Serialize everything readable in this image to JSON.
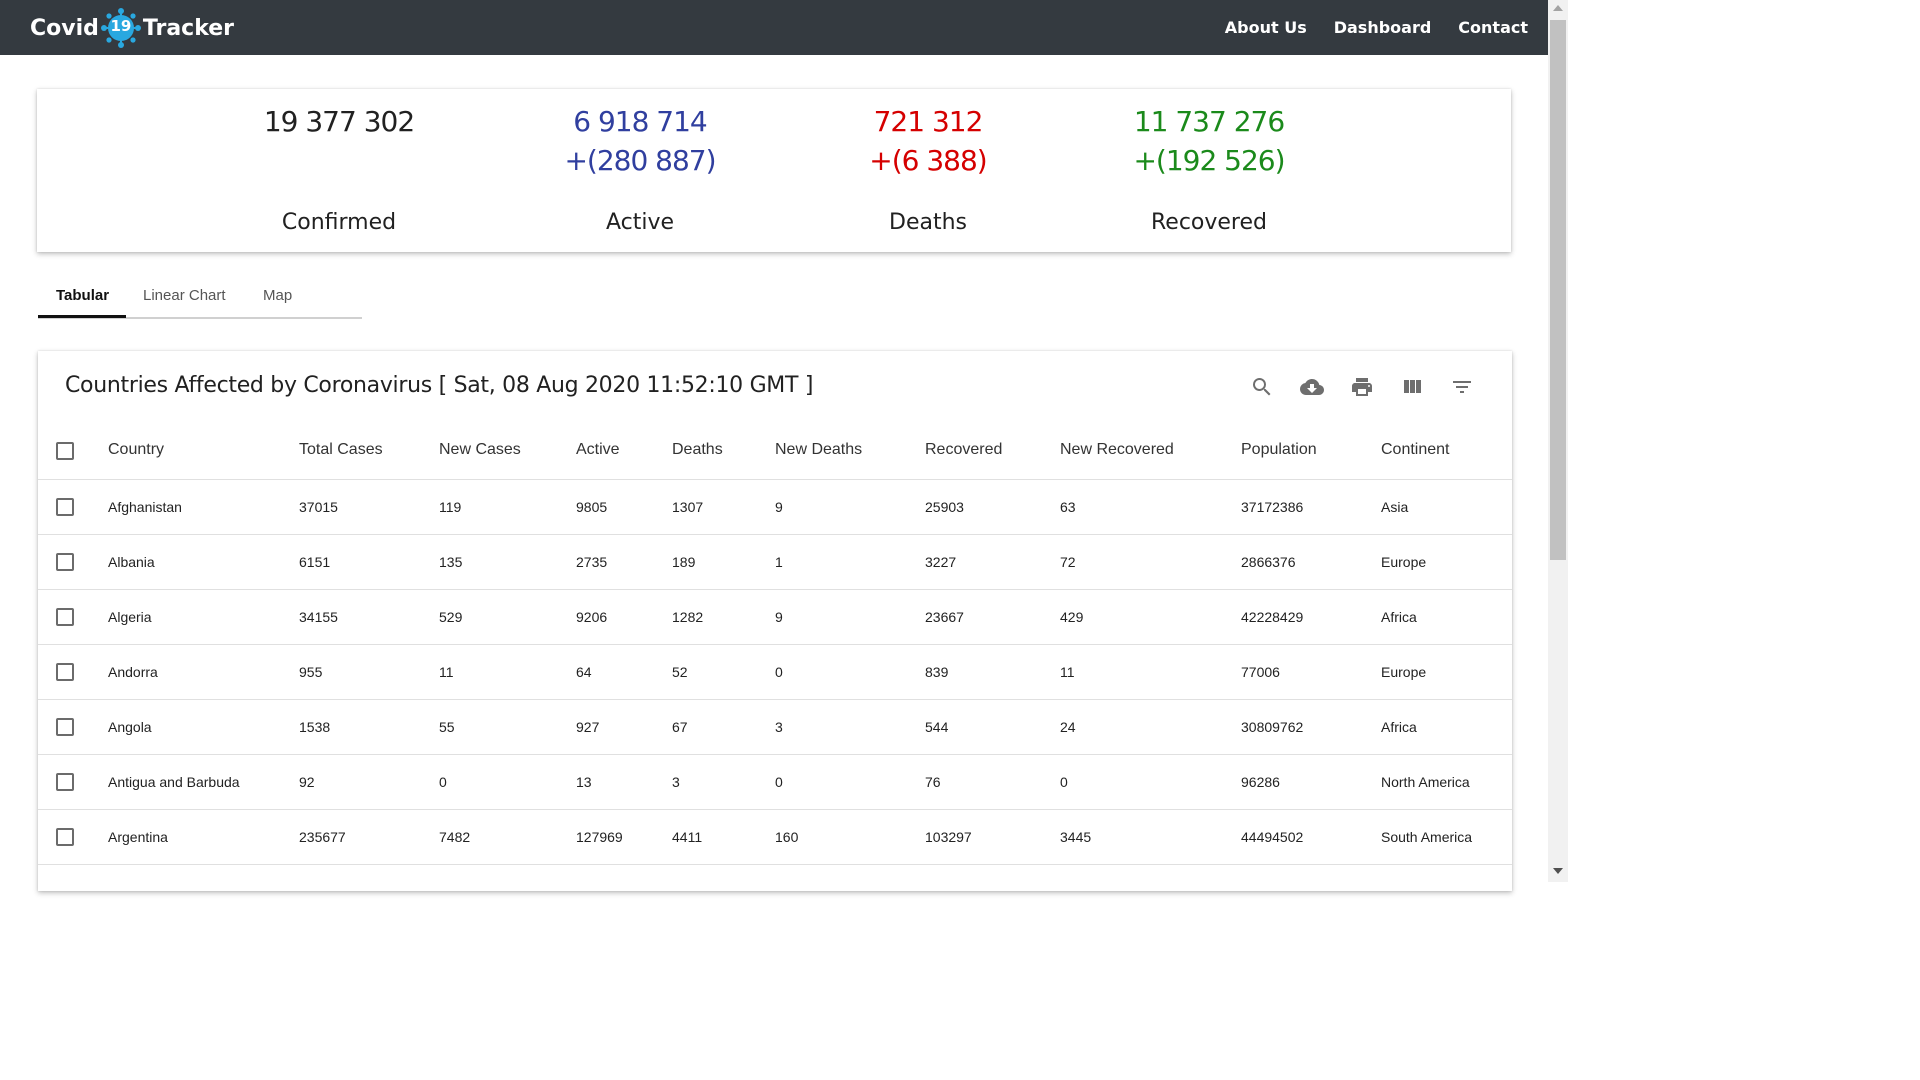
{
  "nav": {
    "brand_left": "Covid",
    "brand_badge": "19",
    "brand_right": "Tracker",
    "links": [
      "About Us",
      "Dashboard",
      "Contact"
    ]
  },
  "summary": {
    "confirmed": {
      "value": "19 377 302",
      "label": "Confirmed",
      "color": "#212121"
    },
    "active": {
      "value": "6 918 714",
      "delta": "+(280 887)",
      "label": "Active",
      "color": "#303f9f"
    },
    "deaths": {
      "value": "721 312",
      "delta": "+(6 388)",
      "label": "Deaths",
      "color": "#d50000"
    },
    "recovered": {
      "value": "11 737 276",
      "delta": "+(192 526)",
      "label": "Recovered",
      "color": "#1b8a1b"
    }
  },
  "tabs": [
    "Tabular",
    "Linear Chart",
    "Map"
  ],
  "table": {
    "title": "Countries Affected by Coronavirus [ Sat, 08 Aug 2020 11:52:10 GMT ]",
    "tools": [
      "search-icon",
      "cloud-download-icon",
      "print-icon",
      "view-column-icon",
      "filter-icon"
    ],
    "columns": [
      "Country",
      "Total Cases",
      "New Cases",
      "Active",
      "Deaths",
      "New Deaths",
      "Recovered",
      "New Recovered",
      "Population",
      "Continent"
    ],
    "rows": [
      [
        "Afghanistan",
        "37015",
        "119",
        "9805",
        "1307",
        "9",
        "25903",
        "63",
        "37172386",
        "Asia"
      ],
      [
        "Albania",
        "6151",
        "135",
        "2735",
        "189",
        "1",
        "3227",
        "72",
        "2866376",
        "Europe"
      ],
      [
        "Algeria",
        "34155",
        "529",
        "9206",
        "1282",
        "9",
        "23667",
        "429",
        "42228429",
        "Africa"
      ],
      [
        "Andorra",
        "955",
        "11",
        "64",
        "52",
        "0",
        "839",
        "11",
        "77006",
        "Europe"
      ],
      [
        "Angola",
        "1538",
        "55",
        "927",
        "67",
        "3",
        "544",
        "24",
        "30809762",
        "Africa"
      ],
      [
        "Antigua and Barbuda",
        "92",
        "0",
        "13",
        "3",
        "0",
        "76",
        "0",
        "96286",
        "North America"
      ],
      [
        "Argentina",
        "235677",
        "7482",
        "127969",
        "4411",
        "160",
        "103297",
        "3445",
        "44494502",
        "South America"
      ]
    ]
  }
}
